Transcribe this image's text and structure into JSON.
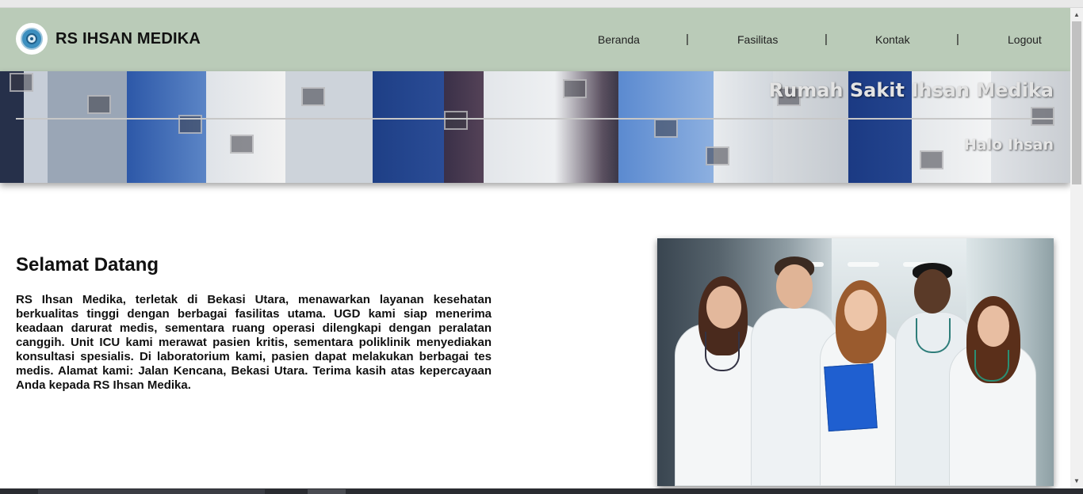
{
  "header": {
    "brand": "RS IHSAN MEDIKA",
    "nav": [
      {
        "label": "Beranda"
      },
      {
        "label": "Fasilitas"
      },
      {
        "label": "Kontak"
      },
      {
        "label": "Logout"
      }
    ],
    "separator": "|"
  },
  "banner": {
    "title": "Rumah Sakit Ihsan Medika",
    "greeting": "Halo Ihsan"
  },
  "main": {
    "heading": "Selamat Datang",
    "paragraph": "RS Ihsan Medika, terletak di Bekasi Utara, menawarkan layanan kesehatan berkualitas tinggi dengan berbagai fasilitas utama. UGD kami siap menerima keadaan darurat medis, sementara ruang operasi dilengkapi dengan peralatan canggih. Unit ICU kami merawat pasien kritis, sementara poliklinik menyediakan konsultasi spesialis. Di laboratorium kami, pasien dapat melakukan berbagai tes medis. Alamat kami: Jalan Kencana, Bekasi Utara. Terima kasih atas kepercayaan Anda kepada RS Ihsan Medika."
  },
  "colors": {
    "navbar_bg": "#bacbb8",
    "text": "#111111"
  },
  "icons": {
    "logo": "hospital-logo-icon",
    "scroll_up": "scroll-up-arrow-icon",
    "scroll_down": "scroll-down-arrow-icon"
  }
}
